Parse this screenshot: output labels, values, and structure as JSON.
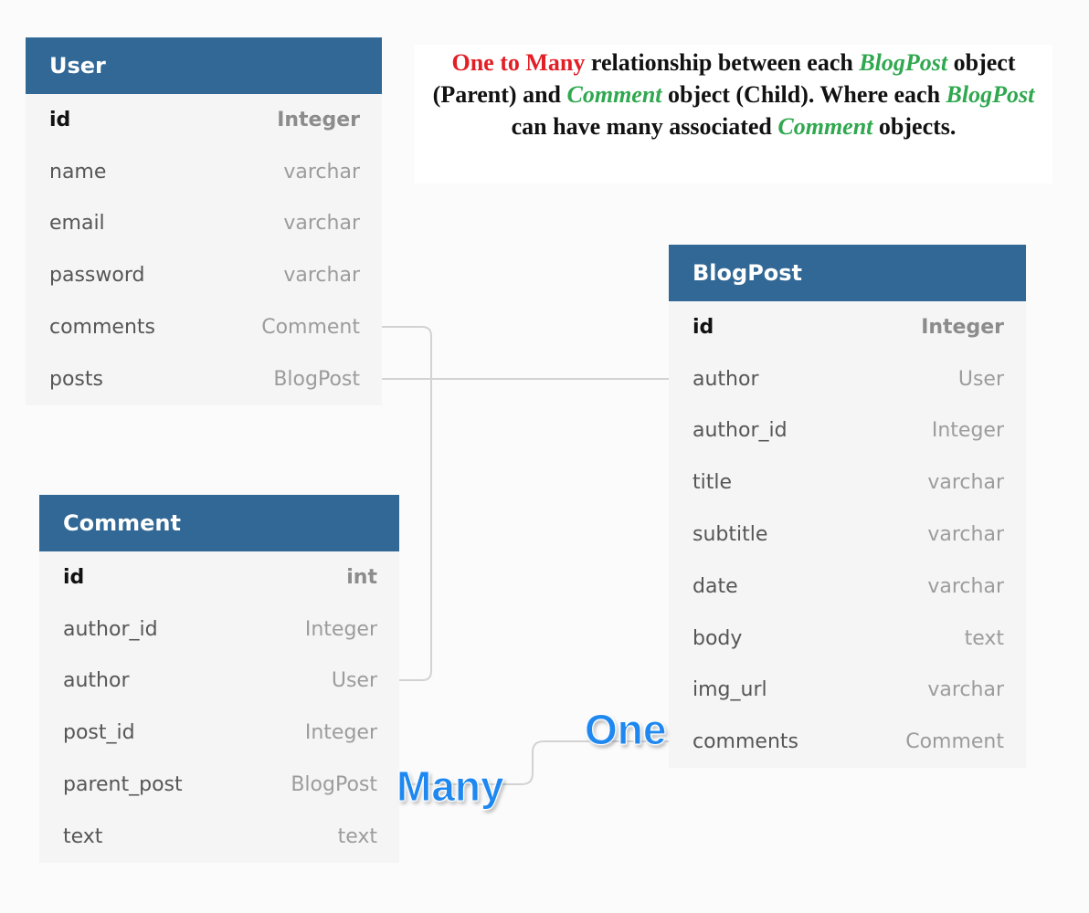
{
  "tables": {
    "user": {
      "title": "User",
      "rows": [
        {
          "name": "id",
          "type": "Integer"
        },
        {
          "name": "name",
          "type": "varchar"
        },
        {
          "name": "email",
          "type": "varchar"
        },
        {
          "name": "password",
          "type": "varchar"
        },
        {
          "name": "comments",
          "type": "Comment"
        },
        {
          "name": "posts",
          "type": "BlogPost"
        }
      ]
    },
    "comment": {
      "title": "Comment",
      "rows": [
        {
          "name": "id",
          "type": "int"
        },
        {
          "name": "author_id",
          "type": "Integer"
        },
        {
          "name": "author",
          "type": "User"
        },
        {
          "name": "post_id",
          "type": "Integer"
        },
        {
          "name": "parent_post",
          "type": "BlogPost"
        },
        {
          "name": "text",
          "type": "text"
        }
      ]
    },
    "blogpost": {
      "title": "BlogPost",
      "rows": [
        {
          "name": "id",
          "type": "Integer"
        },
        {
          "name": "author",
          "type": "User"
        },
        {
          "name": "author_id",
          "type": "Integer"
        },
        {
          "name": "title",
          "type": "varchar"
        },
        {
          "name": "subtitle",
          "type": "varchar"
        },
        {
          "name": "date",
          "type": "varchar"
        },
        {
          "name": "body",
          "type": "text"
        },
        {
          "name": "img_url",
          "type": "varchar"
        },
        {
          "name": "comments",
          "type": "Comment"
        }
      ]
    }
  },
  "note": {
    "t1": "One to Many",
    "t2": " relationship between each ",
    "t3": "BlogPost",
    "t4": " object (Parent) and ",
    "t5": "Comment",
    "t6": " object (Child). Where each ",
    "t7": "BlogPost",
    "t8": " can have many associated ",
    "t9": "Comment",
    "t10": " objects."
  },
  "labels": {
    "one": "One",
    "many": "Many"
  },
  "colors": {
    "header": "#316896",
    "note_red": "#e21f26",
    "note_green": "#2fa84f",
    "cardinality_blue": "#1e88f0"
  }
}
